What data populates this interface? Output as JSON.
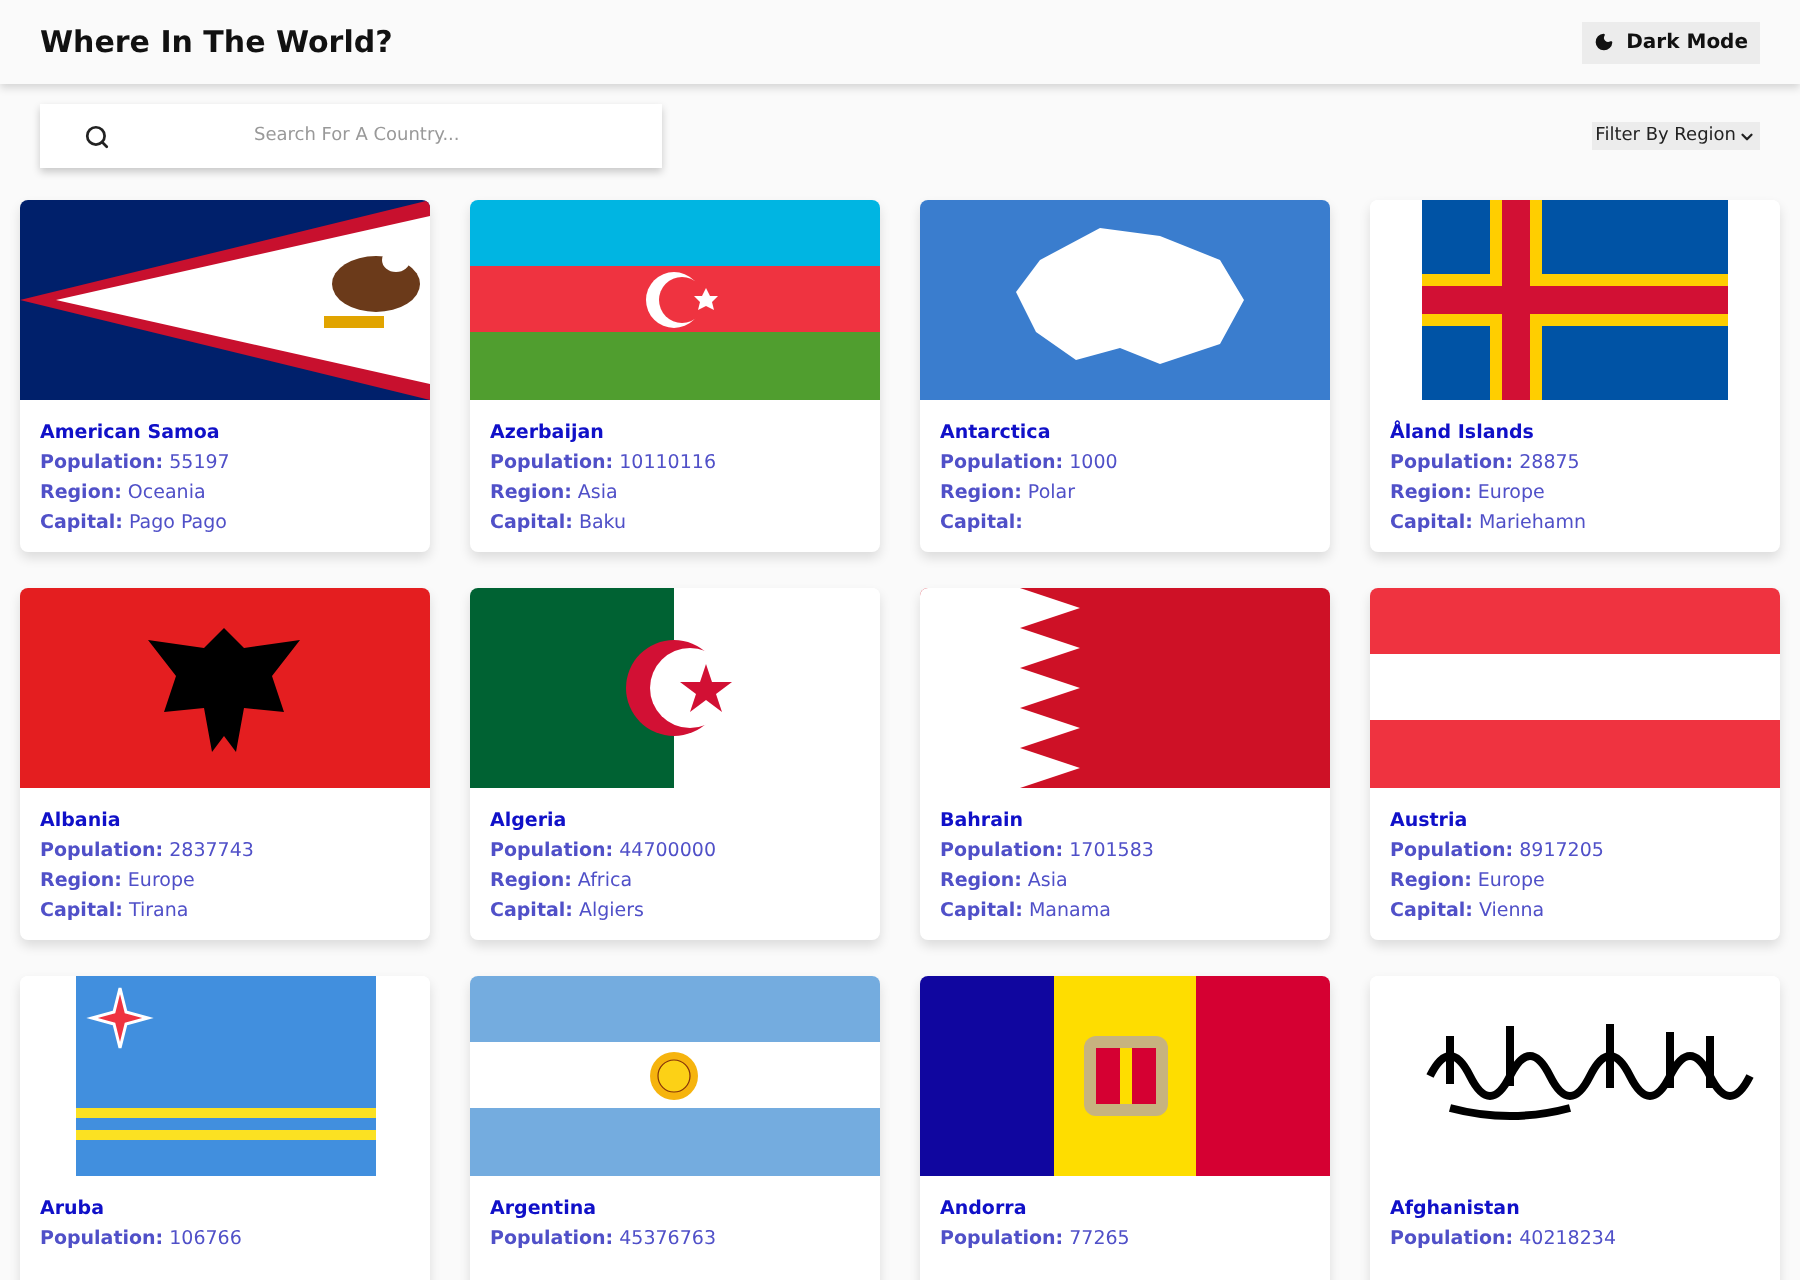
{
  "header": {
    "title": "Where In The World?",
    "theme_button": "Dark Mode"
  },
  "search": {
    "placeholder": "Search For A Country..."
  },
  "filter": {
    "label": "Filter By Region"
  },
  "countries": [
    {
      "name": "American Samoa",
      "kind": "american-samoa",
      "fields": [
        "**Population:** 55197",
        "**Region:** Oceania",
        "**Capital:** Pago Pago"
      ]
    },
    {
      "name": "Azerbaijan",
      "kind": "azerbaijan",
      "fields": [
        "**Population:** 10110116",
        "**Region:** Asia",
        "**Capital:** Baku"
      ]
    },
    {
      "name": "Antarctica",
      "kind": "antarctica",
      "fields": [
        "**Population:** 1000",
        "**Region:** Polar",
        "**Capital:**"
      ]
    },
    {
      "name": "Åland Islands",
      "kind": "aland",
      "fields": [
        "**Population:** 28875",
        "**Region:** Europe",
        "**Capital:** Mariehamn"
      ]
    },
    {
      "name": "Albania",
      "kind": "albania",
      "fields": [
        "**Population:** 2837743",
        "**Region:** Europe",
        "**Capital:** Tirana"
      ]
    },
    {
      "name": "Algeria",
      "kind": "algeria",
      "fields": [
        "**Population:** 44700000",
        "**Region:** Africa",
        "**Capital:** Algiers"
      ]
    },
    {
      "name": "Bahrain",
      "kind": "bahrain",
      "fields": [
        "**Population:** 1701583",
        "**Region:** Asia",
        "**Capital:** Manama"
      ]
    },
    {
      "name": "Austria",
      "kind": "austria",
      "fields": [
        "**Population:** 8917205",
        "**Region:** Europe",
        "**Capital:** Vienna"
      ]
    },
    {
      "name": "Aruba",
      "kind": "aruba",
      "fields": [
        "**Population:** 106766"
      ]
    },
    {
      "name": "Argentina",
      "kind": "argentina",
      "fields": [
        "**Population:** 45376763"
      ]
    },
    {
      "name": "Andorra",
      "kind": "andorra",
      "fields": [
        "**Population:** 77265"
      ]
    },
    {
      "name": "Afghanistan",
      "kind": "afghanistan",
      "fields": [
        "**Population:** 40218234"
      ]
    }
  ]
}
